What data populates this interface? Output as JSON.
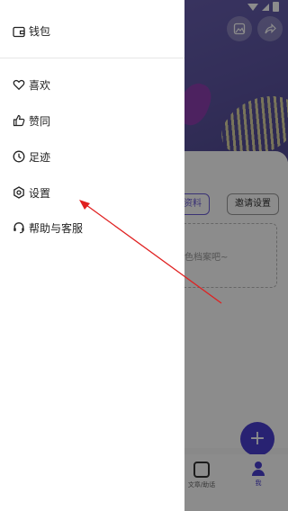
{
  "background": {
    "profile_buttons": {
      "edit": "编辑资料",
      "invite": "邀请设置"
    },
    "empty_hint": "色档案吧~",
    "tabs": [
      {
        "label": "文章/助话",
        "icon": "note-icon"
      },
      {
        "label": "我",
        "icon": "person-icon"
      }
    ],
    "fab_label": "+",
    "accent": "#4a3fd0"
  },
  "drawer": {
    "wallet": {
      "label": "钱包",
      "icon": "wallet-icon"
    },
    "items": [
      {
        "label": "喜欢",
        "icon": "heart-icon"
      },
      {
        "label": "赞同",
        "icon": "thumbs-up-icon"
      },
      {
        "label": "足迹",
        "icon": "clock-icon"
      },
      {
        "label": "设置",
        "icon": "gear-icon"
      },
      {
        "label": "帮助与客服",
        "icon": "headset-icon"
      }
    ]
  },
  "annotation": {
    "color": "#e02020",
    "points_to": "设置"
  }
}
